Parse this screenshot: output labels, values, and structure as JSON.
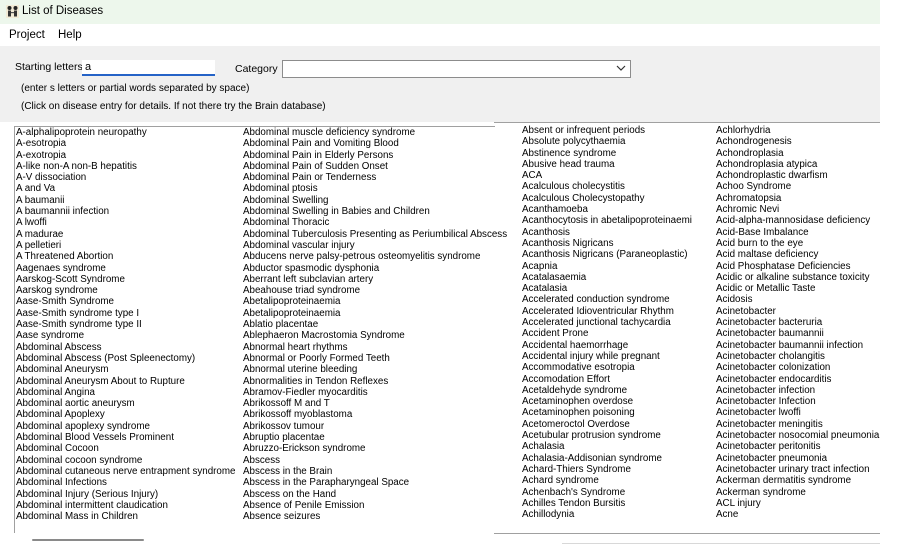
{
  "window": {
    "title": "List of Diseases",
    "icon": "app-icon"
  },
  "menu": {
    "items": [
      {
        "label": "Project"
      },
      {
        "label": "Help"
      }
    ]
  },
  "search": {
    "label": "Starting letters",
    "value": "a",
    "category_label": "Category",
    "category_value": "",
    "hint_1": "(enter s letters or partial words separated by space)",
    "hint_2": "(Click on disease entry for details. If not there try the Brain database)"
  },
  "lists": {
    "col1": [
      "A-alphalipoprotein neuropathy",
      "A-esotropia",
      "A-exotropia",
      "A-like non-A non-B hepatitis",
      "A-V dissociation",
      "A and Va",
      "A baumanii",
      "A baumannii infection",
      "A lwoffi",
      "A madurae",
      "A pelletieri",
      "A Threatened Abortion",
      "Aagenaes syndrome",
      "Aarskog-Scott Syndrome",
      "Aarskog syndrome",
      "Aase-Smith Syndrome",
      "Aase-Smith syndrome type I",
      "Aase-Smith syndrome type II",
      "Aase syndrome",
      "Abdominal Abscess",
      "Abdominal Abscess (Post Spleenectomy)",
      "Abdominal Aneurysm",
      "Abdominal Aneurysm About to Rupture",
      "Abdominal Angina",
      "Abdominal aortic aneurysm",
      "Abdominal Apoplexy",
      "Abdominal apoplexy syndrome",
      "Abdominal Blood Vessels Prominent",
      "Abdominal Cocoon",
      "Abdominal cocoon syndrome",
      "Abdominal cutaneous nerve entrapment syndrome",
      "Abdominal Infections",
      "Abdominal Injury (Serious Injury)",
      "Abdominal intermittent claudication",
      "Abdominal Mass in Children"
    ],
    "col2": [
      "Abdominal muscle deficiency syndrome",
      "Abdominal Pain and Vomiting Blood",
      "Abdominal Pain in Elderly Persons",
      "Abdominal Pain of Sudden Onset",
      "Abdominal Pain or Tenderness",
      "Abdominal ptosis",
      "Abdominal Swelling",
      "Abdominal Swelling in Babies and Children",
      "Abdominal Thoracic",
      "Abdominal Tuberculosis Presenting as Periumbilical Abscess",
      "Abdominal vascular injury",
      "Abducens nerve palsy-petrous osteomyelitis syndrome",
      "Abductor spasmodic dysphonia",
      "Aberrant left subclavian artery",
      "Abeahouse triad syndrome",
      "Abetalipoproteinaemia",
      "Abetalipoproteinaemia",
      "Ablatio placentae",
      "Ablephaeron Macrostomia Syndrome",
      "Abnormal heart rhythms",
      "Abnormal or Poorly Formed Teeth",
      "Abnormal uterine bleeding",
      "Abnormalities in Tendon Reflexes",
      "Abramov-Fiedler myocarditis",
      "Abrikossoff M and T",
      "Abrikossoff myoblastoma",
      "Abrikossov tumour",
      "Abruptio placentae",
      "Abruzzo-Erickson syndrome",
      "Abscess",
      "Abscess in the Brain",
      "Abscess in the Parapharyngeal Space",
      "Abscess on the Hand",
      "Absence of Penile Emission",
      "Absence seizures"
    ],
    "col3": [
      "Absent or infrequent periods",
      "Absolute polycythaemia",
      "Abstinence syndrome",
      "Abusive head trauma",
      "ACA",
      "Acalculous cholecystitis",
      "Acalculous Cholecystopathy",
      "Acanthamoeba",
      "Acanthocytosis in abetalipoproteinaemi",
      "Acanthosis",
      "Acanthosis Nigricans",
      "Acanthosis Nigricans (Paraneoplastic)",
      "Acapnia",
      "Acatalasaemia",
      "Acatalasia",
      "Accelerated conduction syndrome",
      "Accelerated Idioventricular Rhythm",
      "Accelerated junctional tachycardia",
      "Accident Prone",
      "Accidental haemorrhage",
      "Accidental injury while pregnant",
      "Accommodative esotropia",
      "Accomodation Effort",
      "Acetaldehyde syndrome",
      "Acetaminophen overdose",
      "Acetaminophen poisoning",
      "Acetomeroctol Overdose",
      "Acetubular protrusion syndrome",
      "Achalasia",
      "Achalasia-Addisonian syndrome",
      "Achard-Thiers Syndrome",
      "Achard syndrome",
      "Achenbach's Syndrome",
      "Achilles Tendon Bursitis",
      "Achillodynia"
    ],
    "col4": [
      "Achlorhydria",
      "Achondrogenesis",
      "Achondroplasia",
      "Achondroplasia atypica",
      "Achondroplastic dwarfism",
      "Achoo Syndrome",
      "Achromatopsia",
      "Achromic Nevi",
      "Acid-alpha-mannosidase deficiency",
      "Acid-Base Imbalance",
      "Acid burn to the eye",
      "Acid maltase deficiency",
      "Acid Phosphatase Deficiencies",
      "Acidic or alkaline substance toxicity",
      "Acidic or Metallic Taste",
      "Acidosis",
      "Acinetobacter",
      "Acinetobacter bacteruria",
      "Acinetobacter baumannii",
      "Acinetobacter baumannii infection",
      "Acinetobacter cholangitis",
      "Acinetobacter colonization",
      "Acinetobacter endocarditis",
      "Acinetobacter infection",
      "Acinetobacter Infection",
      "Acinetobacter lwoffi",
      "Acinetobacter meningitis",
      "Acinetobacter nosocomial pneumonia",
      "Acinetobacter peritonitis",
      "Acinetobacter pneumonia",
      "Acinetobacter urinary tract infection",
      "Ackerman dermatitis syndrome",
      "Ackerman syndrome",
      "ACL injury",
      "Acne"
    ]
  }
}
